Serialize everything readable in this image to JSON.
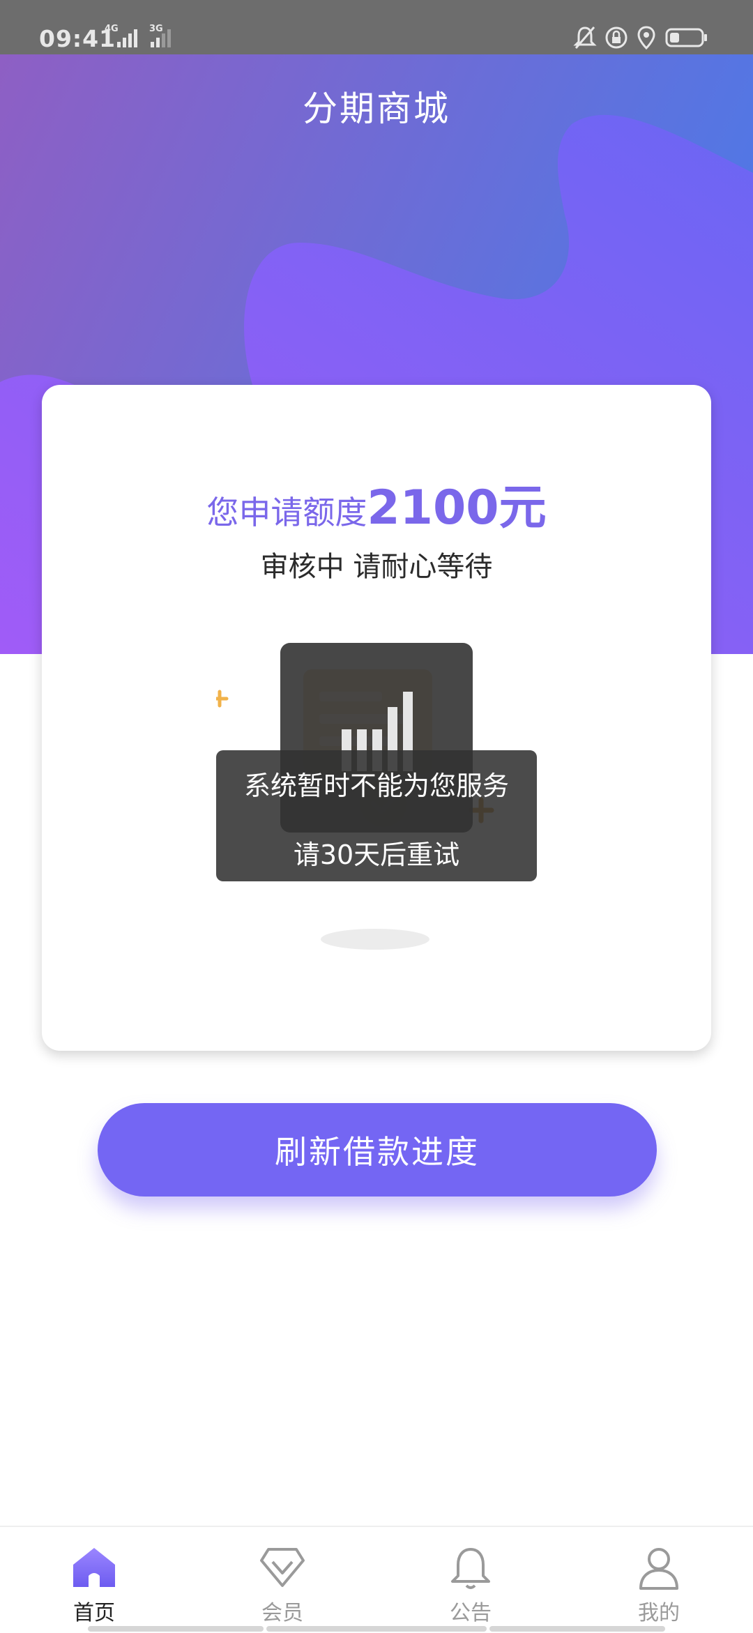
{
  "status_bar": {
    "time": "09:41",
    "network_1": "4G",
    "network_2": "3G",
    "icons": [
      "bell-off-icon",
      "rotation-lock-icon",
      "location-icon",
      "battery-icon"
    ]
  },
  "header": {
    "title": "分期商城"
  },
  "card": {
    "quota_prefix": "您申请额度",
    "quota_amount": "2100元",
    "status_text": "审核中 请耐心等待"
  },
  "toast": {
    "line1": "系统暂时不能为您服务",
    "line2": "请30天后重试"
  },
  "actions": {
    "refresh_label": "刷新借款进度"
  },
  "tab_bar": {
    "items": [
      {
        "label": "首页",
        "icon": "home-icon",
        "active": true
      },
      {
        "label": "会员",
        "icon": "diamond-icon",
        "active": false
      },
      {
        "label": "公告",
        "icon": "bell-icon",
        "active": false
      },
      {
        "label": "我的",
        "icon": "user-icon",
        "active": false
      }
    ]
  },
  "colors": {
    "accent": "#7466f3",
    "quota_text": "#7a67ea",
    "status_bar": "#6d6d6d",
    "gradient_start": "#8e5fc4",
    "gradient_end": "#4f78e6"
  }
}
